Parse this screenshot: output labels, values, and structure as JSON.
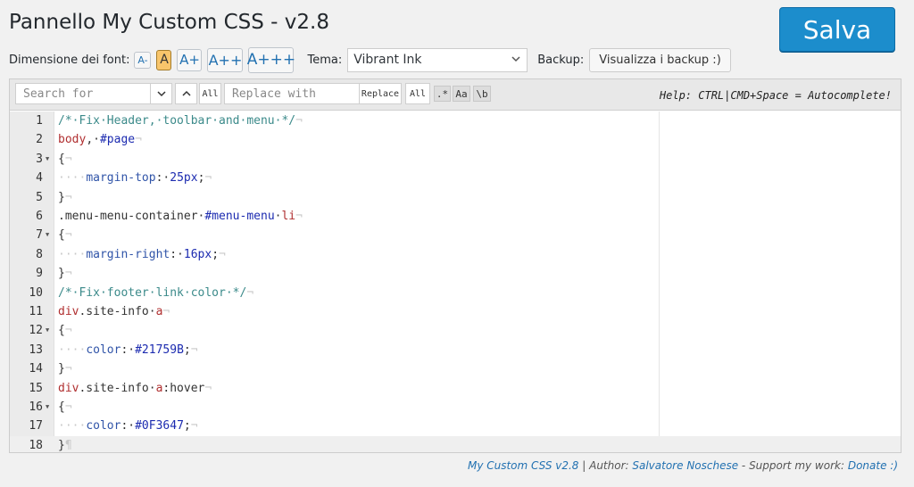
{
  "title": "Pannello My Custom CSS - v2.8",
  "save_label": "Salva",
  "font_size": {
    "label": "Dimensione dei font:",
    "buttons": [
      "A-",
      "A",
      "A+",
      "A++",
      "A+++"
    ],
    "active": "A"
  },
  "theme": {
    "label": "Tema:",
    "value": "Vibrant Ink"
  },
  "backup": {
    "label": "Backup:",
    "button": "Visualizza i backup :)"
  },
  "search": {
    "search_placeholder": "Search for",
    "all_label": "All",
    "replace_placeholder": "Replace with",
    "replace_label": "Replace",
    "replace_all_label": "All",
    "regex_label": ".*",
    "case_label": "Aa",
    "word_label": "\\b"
  },
  "help_text": "Help: CTRL|CMD+Space = Autocomplete!",
  "editor": {
    "active_line": 18,
    "lines": [
      {
        "n": "1",
        "fold": false
      },
      {
        "n": "2",
        "fold": false
      },
      {
        "n": "3",
        "fold": true
      },
      {
        "n": "4",
        "fold": false
      },
      {
        "n": "5",
        "fold": false
      },
      {
        "n": "6",
        "fold": false
      },
      {
        "n": "7",
        "fold": true
      },
      {
        "n": "8",
        "fold": false
      },
      {
        "n": "9",
        "fold": false
      },
      {
        "n": "10",
        "fold": false
      },
      {
        "n": "11",
        "fold": false
      },
      {
        "n": "12",
        "fold": true
      },
      {
        "n": "13",
        "fold": false
      },
      {
        "n": "14",
        "fold": false
      },
      {
        "n": "15",
        "fold": false
      },
      {
        "n": "16",
        "fold": true
      },
      {
        "n": "17",
        "fold": false
      },
      {
        "n": "18",
        "fold": false
      }
    ],
    "code": [
      [
        [
          "comment",
          "/*·Fix·Header,·toolbar·and·menu·*/"
        ],
        [
          "inv",
          "¬"
        ]
      ],
      [
        [
          "sel",
          "body"
        ],
        [
          "txt",
          ",·"
        ],
        [
          "id",
          "#page"
        ],
        [
          "inv",
          "¬"
        ]
      ],
      [
        [
          "txt",
          "{"
        ],
        [
          "inv",
          "¬"
        ]
      ],
      [
        [
          "inv",
          "····"
        ],
        [
          "prop",
          "margin-top"
        ],
        [
          "txt",
          ":·"
        ],
        [
          "num",
          "25px"
        ],
        [
          "txt",
          ";"
        ],
        [
          "inv",
          "¬"
        ]
      ],
      [
        [
          "txt",
          "}"
        ],
        [
          "inv",
          "¬"
        ]
      ],
      [
        [
          "txt",
          ".menu-menu-container·"
        ],
        [
          "id",
          "#menu-menu"
        ],
        [
          "txt",
          "·"
        ],
        [
          "sel",
          "li"
        ],
        [
          "inv",
          "¬"
        ]
      ],
      [
        [
          "txt",
          "{"
        ],
        [
          "inv",
          "¬"
        ]
      ],
      [
        [
          "inv",
          "····"
        ],
        [
          "prop",
          "margin-right"
        ],
        [
          "txt",
          ":·"
        ],
        [
          "num",
          "16px"
        ],
        [
          "txt",
          ";"
        ],
        [
          "inv",
          "¬"
        ]
      ],
      [
        [
          "txt",
          "}"
        ],
        [
          "inv",
          "¬"
        ]
      ],
      [
        [
          "comment",
          "/*·Fix·footer·link·color·*/"
        ],
        [
          "inv",
          "¬"
        ]
      ],
      [
        [
          "sel",
          "div"
        ],
        [
          "txt",
          ".site-info·"
        ],
        [
          "sel",
          "a"
        ],
        [
          "inv",
          "¬"
        ]
      ],
      [
        [
          "txt",
          "{"
        ],
        [
          "inv",
          "¬"
        ]
      ],
      [
        [
          "inv",
          "····"
        ],
        [
          "prop",
          "color"
        ],
        [
          "txt",
          ":·"
        ],
        [
          "num",
          "#21759B"
        ],
        [
          "txt",
          ";"
        ],
        [
          "inv",
          "¬"
        ]
      ],
      [
        [
          "txt",
          "}"
        ],
        [
          "inv",
          "¬"
        ]
      ],
      [
        [
          "sel",
          "div"
        ],
        [
          "txt",
          ".site-info·"
        ],
        [
          "sel",
          "a"
        ],
        [
          "txt",
          ":hover"
        ],
        [
          "inv",
          "¬"
        ]
      ],
      [
        [
          "txt",
          "{"
        ],
        [
          "inv",
          "¬"
        ]
      ],
      [
        [
          "inv",
          "····"
        ],
        [
          "prop",
          "color"
        ],
        [
          "txt",
          ":·"
        ],
        [
          "num",
          "#0F3647"
        ],
        [
          "txt",
          ";"
        ],
        [
          "inv",
          "¬"
        ]
      ],
      [
        [
          "txt",
          "}"
        ],
        [
          "inv",
          "¶"
        ]
      ]
    ]
  },
  "footer": {
    "plugin": "My Custom CSS v2.8",
    "sep1": " | Author: ",
    "author": "Salvatore Noschese",
    "sep2": " - Support my work: ",
    "donate": "Donate :)"
  },
  "colors": {
    "save": "#1c8dcc",
    "active_font": "#f8c56b",
    "link": "#2271b1"
  }
}
